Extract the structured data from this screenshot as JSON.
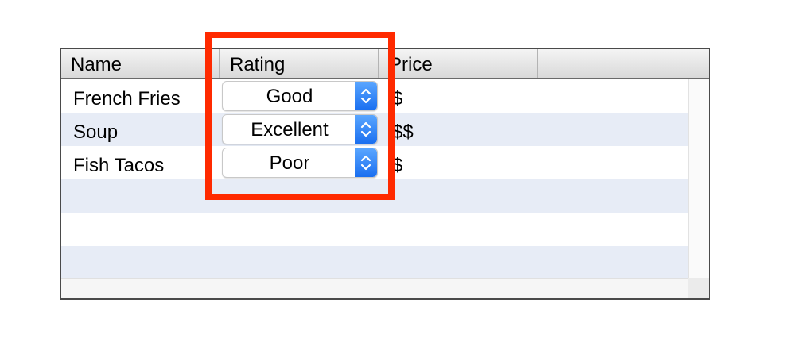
{
  "table": {
    "columns": [
      {
        "label": "Name"
      },
      {
        "label": "Rating"
      },
      {
        "label": "Price"
      },
      {
        "label": ""
      }
    ],
    "rows": [
      {
        "name": "French Fries",
        "rating": "Good",
        "price": "$"
      },
      {
        "name": "Soup",
        "rating": "Excellent",
        "price": "$$"
      },
      {
        "name": "Fish Tacos",
        "rating": "Poor",
        "price": "$"
      }
    ],
    "empty_row_count": 3
  },
  "colors": {
    "row_alternate": "#e7ecf6",
    "popup_arrow_accent": "#1a6ff0",
    "highlight": "#ff2a00"
  },
  "icons": {
    "popup_arrows": "chevron-up-down-icon"
  }
}
